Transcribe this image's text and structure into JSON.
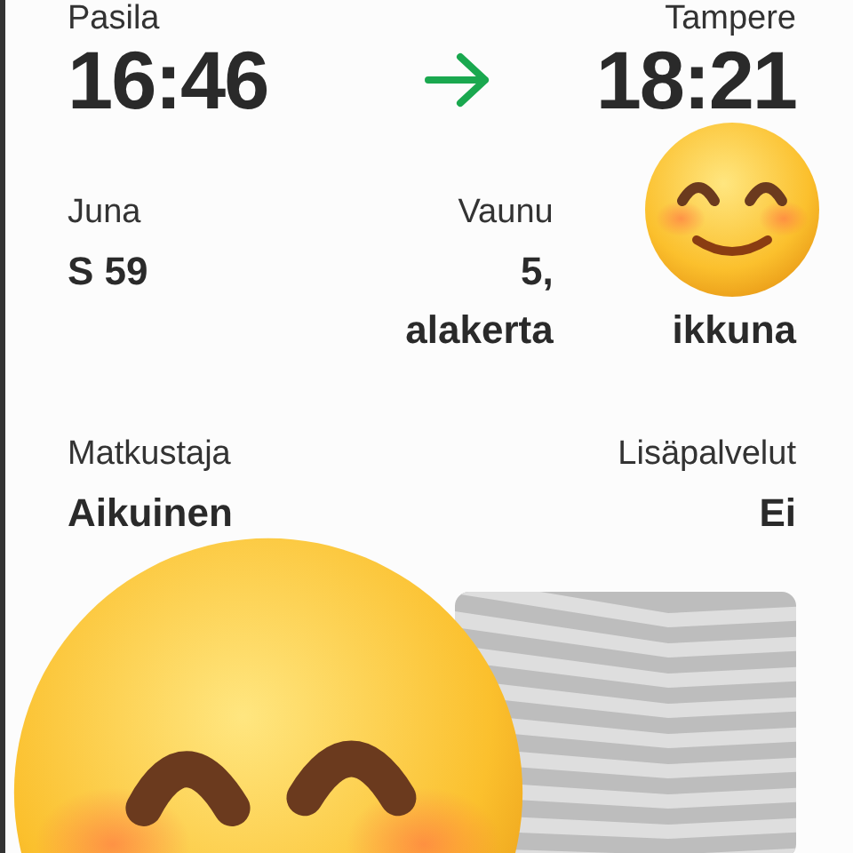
{
  "route": {
    "from": "Pasila",
    "to": "Tampere",
    "departure": "16:46",
    "arrival": "18:21"
  },
  "details": [
    {
      "label": "Juna",
      "value": "S 59"
    },
    {
      "label": "Vaunu",
      "value": "5, alakerta"
    }
  ],
  "seat": {
    "value": "ikkuna"
  },
  "passenger": {
    "label": "Matkustaja",
    "value": "Aikuinen"
  },
  "extras": {
    "label": "Lisäpalvelut",
    "value": "Ei"
  }
}
